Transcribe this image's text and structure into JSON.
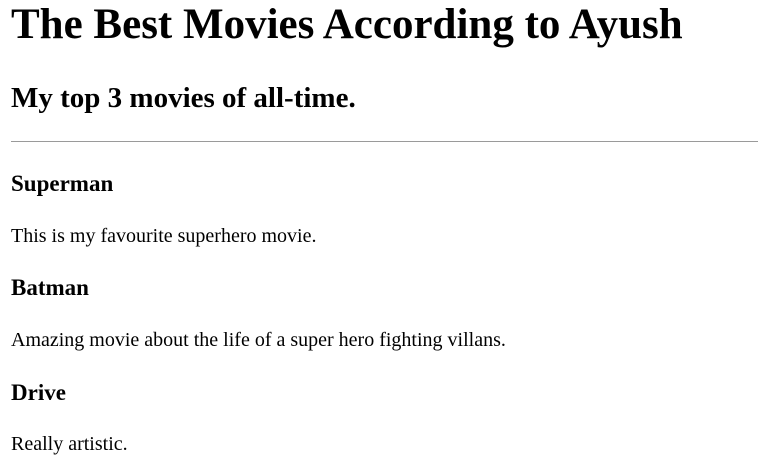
{
  "page": {
    "title": "The Best Movies According to Ayush",
    "subtitle": "My top 3 movies of all-time."
  },
  "movies": [
    {
      "title": "Superman",
      "description": "This is my favourite superhero movie."
    },
    {
      "title": "Batman",
      "description": "Amazing movie about the life of a super hero fighting villans."
    },
    {
      "title": "Drive",
      "description": "Really artistic."
    }
  ]
}
